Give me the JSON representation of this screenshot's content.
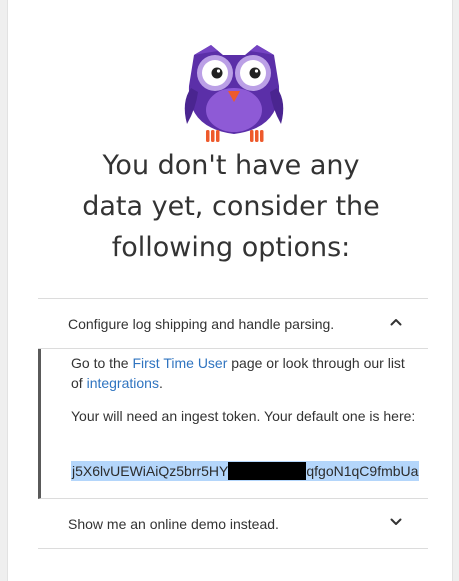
{
  "empty_state": {
    "heading_line1": "You don't have any",
    "heading_line2": "data yet, consider the",
    "heading_line3": "following options:"
  },
  "accordion": {
    "log_shipping": {
      "title": "Configure log shipping and handle parsing.",
      "expanded": true,
      "intro_prefix": "Go to the ",
      "first_time_user_link": "First Time User",
      "intro_middle": " page or look through our list of ",
      "integrations_link": "integrations",
      "intro_suffix": ".",
      "token_text": "Your will need an ingest token. Your default one is here:",
      "token_start": "j5X6lvUEWiAiQz5brr5HY",
      "token_end": "qfgoN1qC9fmbUa"
    },
    "demo": {
      "title": "Show me an online demo instead.",
      "expanded": false
    }
  },
  "colors": {
    "owl_body": "#5b2fa8",
    "owl_belly": "#8e5ad6",
    "owl_beak": "#ee5a2c",
    "link": "#2f74c0",
    "selection": "#b4d6fb"
  },
  "icons": {
    "mascot": "owl-mascot-icon",
    "expanded": "chevron-up-icon",
    "collapsed": "chevron-down-icon"
  }
}
